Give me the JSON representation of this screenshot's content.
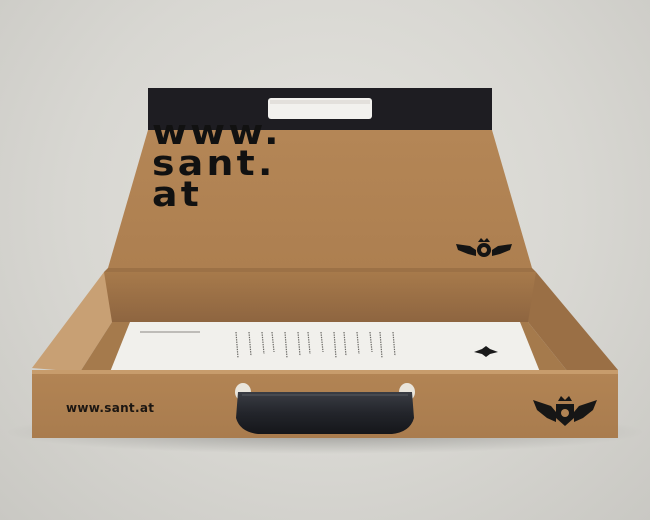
{
  "image": {
    "subject": "kraft cardboard briefcase-style box with open lid and letterhead paper inside",
    "lid_url_text": "www.\nsant.\nat",
    "front_url_text": "www.sant.at",
    "icons": [
      "winged-crest-icon",
      "handle-cutout",
      "briefcase-handle"
    ],
    "colors": {
      "background": "#dcdbd6",
      "cardboard": "#b08253",
      "cardboard_dark": "#7f5b38",
      "lid_top_band": "#1e1d22",
      "handle": "#23252b",
      "paper": "#f1f0ec",
      "print": "#111111"
    }
  }
}
